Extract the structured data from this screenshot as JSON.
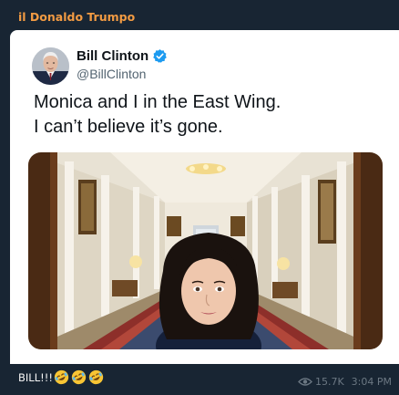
{
  "channel": {
    "sender_name": "il Donaldo Trumpo"
  },
  "tweet": {
    "display_name": "Bill Clinton",
    "handle": "@BillClinton",
    "verified_icon": "verified-badge-icon",
    "text_lines": [
      "Monica and I in the East Wing.",
      "I can’t believe it’s gone."
    ]
  },
  "message": {
    "caption": "BILL!!!",
    "emojis": [
      "rofl-emoji-icon",
      "rofl-emoji-icon",
      "rofl-emoji-icon"
    ],
    "views": "15.7K",
    "time": "3:04 PM"
  },
  "colors": {
    "sender": "#f29b43",
    "bubble": "#182533",
    "meta": "#6c7883",
    "verified": "#1d9bf0"
  }
}
